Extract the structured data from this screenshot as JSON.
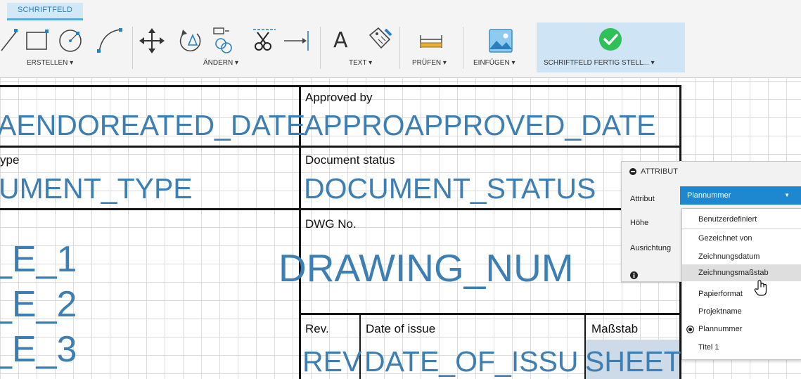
{
  "ribbon": {
    "tab_label": "SCHRIFTFELD",
    "groups": {
      "erstellen": "ERSTELLEN ▾",
      "aendern": "ÄNDERN ▾",
      "text": "TEXT ▾",
      "pruefen": "PRÜFEN ▾",
      "einfuegen": "EINFÜGEN ▾",
      "finish": "SCHRIFTFELD FERTIG STELL... ▾"
    },
    "text_icon_glyph": "A",
    "accent_color": "#5aa9dd",
    "finish_color": "#2fc05a"
  },
  "titleblock": {
    "row1": {
      "left_big": "AENDOREATED_DATE",
      "approved_label": "Approved by",
      "approved_big": "APPROAPPROVED_DATE"
    },
    "row2": {
      "left_label": "ype",
      "left_big": "UMENT_TYPE",
      "status_label": "Document status",
      "status_big": "DOCUMENT_STATUS"
    },
    "row3": {
      "dwg_label": "DWG No.",
      "dwg_big": "DRAWING_NUM",
      "left_lines": [
        "_E_1",
        "_E_2",
        "_E_3"
      ]
    },
    "row4": {
      "rev_label": "Rev.",
      "date_label": "Date of issue",
      "scale_label": "Maßstab",
      "rev_big": "REV",
      "date_big": "DATE_OF_ISSU",
      "sheet_big": "SHEET"
    },
    "text_color": "#3d7eb3"
  },
  "attr_panel": {
    "title": "ATTRIBUT",
    "attribut_label": "Attribut",
    "hoehe_label": "Höhe",
    "ausrichtung_label": "Ausrichtung",
    "selected_value": "Plannummer",
    "options": [
      "Benutzerdefiniert",
      "Gezeichnet von",
      "Zeichnungsdatum",
      "Zeichnungsmaßstab",
      "Papierformat",
      "Projektname",
      "Plannummer",
      "Titel 1"
    ],
    "hovered_option": "Zeichnungsmaßstab",
    "checked_option": "Plannummer",
    "select_color": "#1f87d0"
  }
}
